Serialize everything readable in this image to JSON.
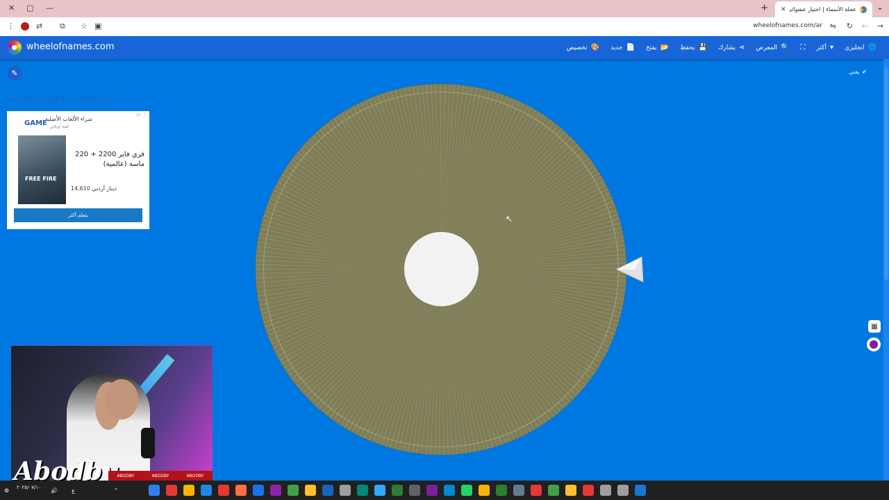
{
  "browser": {
    "tab_title": "عجلة الأسماء | اختيار عشوائي للأ",
    "tab_close": "✕",
    "new_tab": "+",
    "url": "wheelofnames.com/ar"
  },
  "app": {
    "site_name": "wheelofnames.com",
    "menu": [
      {
        "label": "انجليزي",
        "icon": "globe-icon",
        "glyph": "🌐"
      },
      {
        "label": "أكثر",
        "icon": "caret-down-icon",
        "glyph": "▾"
      },
      {
        "label": "",
        "icon": "fullscreen-icon",
        "glyph": "⛶"
      },
      {
        "label": "المعرض",
        "icon": "search-icon",
        "glyph": "🔍"
      },
      {
        "label": "يشارك",
        "icon": "share-icon",
        "glyph": "⋖"
      },
      {
        "label": "يحفظ",
        "icon": "save-icon",
        "glyph": "💾"
      },
      {
        "label": "يفتح",
        "icon": "folder-icon",
        "glyph": "📂"
      },
      {
        "label": "جديد",
        "icon": "new-file-icon",
        "glyph": "📄"
      },
      {
        "label": "تخصيص",
        "icon": "palette-icon",
        "glyph": "🎨"
      }
    ],
    "check_label": "يغني"
  },
  "ad": {
    "links": [
      "الإعلان عن إعلان سيء",
      "إدارة الإعلانات"
    ],
    "adchoices": "▷ ⋮",
    "brand": "GAME",
    "title": "شراء الألعاب الأصلية",
    "subtitle": "لعبة اونلاين",
    "image_text": "FREE FIRE",
    "product": "فري فاير 2200 + 220 ماسة (عالمية)",
    "price": "14,610 دينار أردني",
    "cta": "يتعلم أكثر"
  },
  "stream": {
    "name": "Abodby",
    "bar_items": [
      "ABODBY",
      "ABODBY",
      "ABODBY"
    ]
  },
  "taskbar": {
    "clock": "٢٠٢٥/٠٧/١٠",
    "tray": [
      "⚙",
      "🔊",
      "ع",
      "⌃"
    ],
    "colors": [
      "#2f80ed",
      "#e53935",
      "#ffb300",
      "#1e88e5",
      "#e53935",
      "#ff7043",
      "#1a73e8",
      "#8e24aa",
      "#43a047",
      "#fbc02d",
      "#1565c0",
      "#9e9e9e",
      "#00897b",
      "#31a8ff",
      "#2e7d32",
      "#5f6368",
      "#7b1fa2",
      "#0288d1",
      "#25d366",
      "#f4b400",
      "#2e7d32",
      "#607d8b",
      "#e53935",
      "#43a047",
      "#fbc02d",
      "#e53935",
      "#9e9e9e",
      "#9e9e9e",
      "#1976d2"
    ]
  },
  "colors": {
    "page_bg": "#0078e2",
    "app_bar": "#1865d8",
    "accent": "#1879c7"
  }
}
